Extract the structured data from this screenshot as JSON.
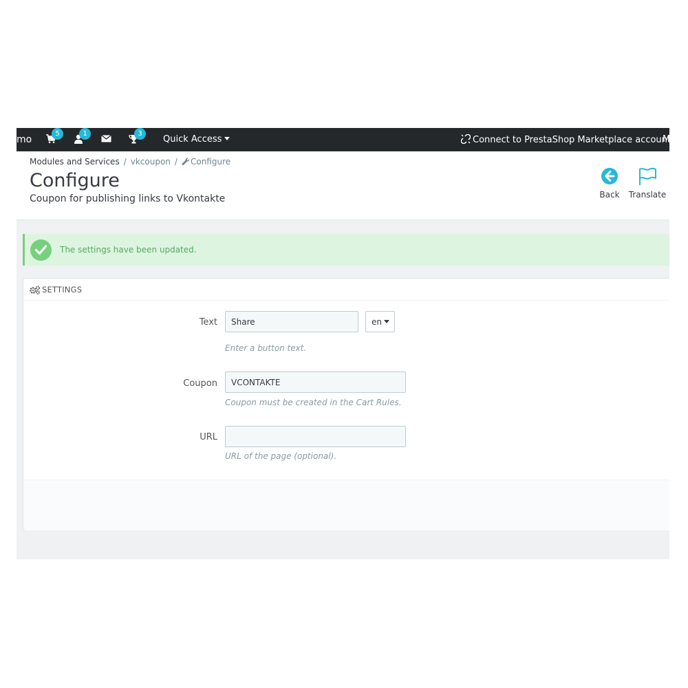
{
  "topbar": {
    "shop_name": "mo",
    "orders_badge": "5",
    "customers_badge": "1",
    "trophy_badge": "3",
    "quick_access": "Quick Access",
    "marketplace": "Connect to PrestaShop Marketplace account",
    "user_menu": "M"
  },
  "breadcrumb": {
    "item1": "Modules and Services",
    "item2": "vkcoupon",
    "item3": "Configure"
  },
  "header": {
    "title": "Configure",
    "subtitle": "Coupon for publishing links to Vkontakte",
    "back_label": "Back",
    "translate_label": "Translate"
  },
  "alert": {
    "message": "The settings have been updated."
  },
  "settings": {
    "heading": "SETTINGS",
    "text_label": "Text",
    "text_value": "Share",
    "lang": "en",
    "text_help": "Enter a button text.",
    "coupon_label": "Coupon",
    "coupon_value": "VCONTAKTE",
    "coupon_help": "Coupon must be created in the Cart Rules.",
    "url_label": "URL",
    "url_value": "",
    "url_help": "URL of the page (optional)."
  },
  "colors": {
    "topbar_bg": "#25282b",
    "accent": "#25b9d7",
    "success": "#78d07d",
    "success_bg": "#dcf4e0"
  }
}
